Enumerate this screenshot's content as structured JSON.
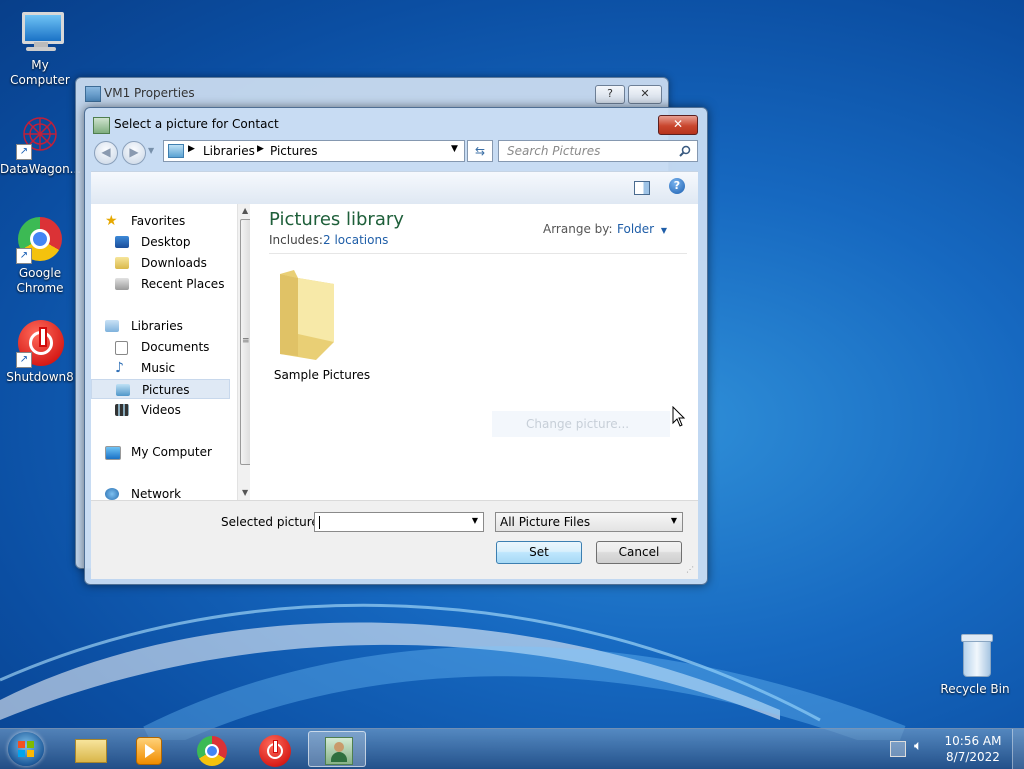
{
  "desktop": {
    "icons": [
      {
        "label": "My Computer",
        "icon": "computer-icon"
      },
      {
        "label": "DataWagon...",
        "icon": "datawagon-icon"
      },
      {
        "label": "Google Chrome",
        "icon": "chrome-icon"
      },
      {
        "label": "Shutdown8",
        "icon": "power-icon"
      },
      {
        "label": "Recycle Bin",
        "icon": "recycle-bin-icon"
      }
    ]
  },
  "parent_window": {
    "title": "VM1 Properties",
    "help_label": "?",
    "close_label": "✕"
  },
  "dialog": {
    "title": "Select a picture for Contact",
    "close_label": "✕",
    "breadcrumb": [
      "Libraries",
      "Pictures"
    ],
    "search_placeholder": "Search Pictures",
    "nav": {
      "favorites_label": "Favorites",
      "favorites": [
        "Desktop",
        "Downloads",
        "Recent Places"
      ],
      "libraries_label": "Libraries",
      "libraries": [
        "Documents",
        "Music",
        "Pictures",
        "Videos"
      ],
      "selected": "Pictures",
      "computer_label": "My Computer",
      "network_label": "Network"
    },
    "library": {
      "title": "Pictures library",
      "includes_label": "Includes:",
      "locations_link": "2 locations",
      "arrange_label": "Arrange by:",
      "arrange_value": "Folder",
      "items": [
        {
          "name": "Sample Pictures",
          "icon": "folder-icon"
        }
      ],
      "tooltip": "Change picture..."
    },
    "bottom": {
      "selected_label": "Selected picture:",
      "selected_value": "",
      "filter_value": "All Picture Files",
      "set_label": "Set",
      "cancel_label": "Cancel"
    }
  },
  "taskbar": {
    "items": [
      "start-orb-icon",
      "explorer-icon",
      "media-player-icon",
      "chrome-icon",
      "power-icon",
      "contact-icon"
    ],
    "clock_time": "10:56 AM",
    "clock_date": "8/7/2022"
  }
}
